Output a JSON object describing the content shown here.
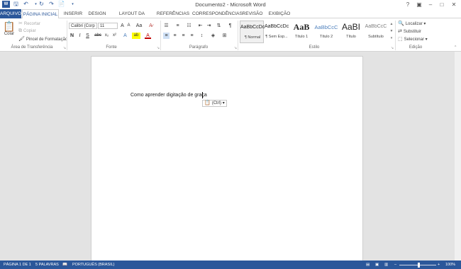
{
  "window": {
    "title": "Documento2 - Microsoft Word",
    "quick_access": [
      "word-icon",
      "save-icon",
      "undo-icon",
      "redo-icon",
      "repeat-icon",
      "customize-icon"
    ],
    "controls": {
      "help": "?",
      "ribbon_options": "▣",
      "minimize": "–",
      "maximize": "□",
      "close": "✕"
    }
  },
  "tabs": [
    {
      "label": "ARQUIVO"
    },
    {
      "label": "PÁGINA INICIAL"
    },
    {
      "label": "INSERIR"
    },
    {
      "label": "DESIGN"
    },
    {
      "label": "LAYOUT DA PÁGINA"
    },
    {
      "label": "REFERÊNCIAS"
    },
    {
      "label": "CORRESPONDÊNCIAS"
    },
    {
      "label": "REVISÃO"
    },
    {
      "label": "EXIBIÇÃO"
    }
  ],
  "clipboard": {
    "paste": "Colar",
    "cut": "Recortar",
    "copy": "Copiar",
    "format_painter": "Pincel de Formatação",
    "group_label": "Área de Transferência"
  },
  "font": {
    "name": "Calibri (Corp",
    "size": "11",
    "bold": "N",
    "italic": "I",
    "underline": "S",
    "strike": "abc",
    "subscript": "x₂",
    "superscript": "x²",
    "grow": "A",
    "shrink": "A",
    "case": "Aa",
    "effects": "A",
    "highlight": "ab",
    "color": "A",
    "group_label": "Fonte"
  },
  "paragraph": {
    "group_label": "Parágrafo",
    "pilcrow": "¶"
  },
  "styles": {
    "group_label": "Estilo",
    "items": [
      {
        "sample": "AaBbCcDc",
        "name": "¶ Normal"
      },
      {
        "sample": "AaBbCcDc",
        "name": "¶ Sem Esp..."
      },
      {
        "sample": "AaB",
        "name": "Título 1"
      },
      {
        "sample": "AaBbCcC",
        "name": "Título 2"
      },
      {
        "sample": "AaBI",
        "name": "Título"
      },
      {
        "sample": "AaBbCcC",
        "name": "Subtítulo"
      }
    ]
  },
  "editing": {
    "find": "Localizar",
    "replace": "Substituir",
    "select": "Selecionar",
    "group_label": "Edição"
  },
  "document": {
    "text": "Como aprender digitação de graça",
    "paste_options": "(Ctrl)"
  },
  "statusbar": {
    "page": "PÁGINA 1 DE 1",
    "words": "5 PALAVRAS",
    "language": "PORTUGUÊS (BRASIL)",
    "zoom": "100%",
    "zoom_level": 1.0
  },
  "colors": {
    "accent": "#2b579a",
    "highlight": "#ffff00",
    "font_color": "#c00000"
  }
}
